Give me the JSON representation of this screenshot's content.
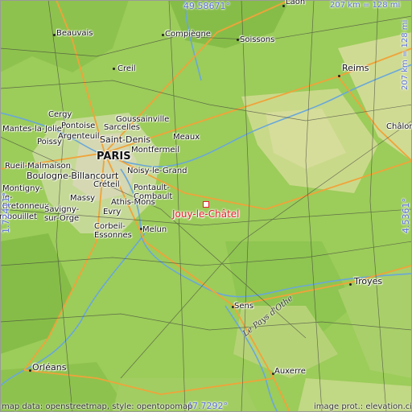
{
  "map": {
    "coordinates": {
      "top": "49.58671°",
      "bottom": "47.7292°",
      "left": "1.72411°",
      "right": "4.5361°",
      "scale_top": "207 km = 128 mi",
      "scale_right": "207 km = 128 mi"
    },
    "focus_place": "Jouy-le-Châtel",
    "places": [
      {
        "name": "Laon"
      },
      {
        "name": "Beauvais"
      },
      {
        "name": "Compiègne"
      },
      {
        "name": "Soissons"
      },
      {
        "name": "Creil"
      },
      {
        "name": "Reims"
      },
      {
        "name": "Goussainville"
      },
      {
        "name": "Cergy"
      },
      {
        "name": "Pontoise"
      },
      {
        "name": "Sarcelles"
      },
      {
        "name": "Mantes-la-Jolie"
      },
      {
        "name": "Argenteuil"
      },
      {
        "name": "Saint-Denis"
      },
      {
        "name": "Poissy"
      },
      {
        "name": "Meaux"
      },
      {
        "name": "Montfermeil"
      },
      {
        "name": "PARIS"
      },
      {
        "name": "Châlons-en-Champagne"
      },
      {
        "name": "Rueil-Malmaison"
      },
      {
        "name": "Boulogne-Billancourt"
      },
      {
        "name": "Noisy-le-Grand"
      },
      {
        "name": "Créteil"
      },
      {
        "name": "Pontault-Combault"
      },
      {
        "name": "Montigny-le-Bretonneux"
      },
      {
        "name": "Massy"
      },
      {
        "name": "Athis-Mons"
      },
      {
        "name": "Rambouillet"
      },
      {
        "name": "Savigny-sur-Orge"
      },
      {
        "name": "Evry"
      },
      {
        "name": "Corbeil-Essonnes"
      },
      {
        "name": "Melun"
      },
      {
        "name": "Troyes"
      },
      {
        "name": "Sens"
      },
      {
        "name": "Orléans"
      },
      {
        "name": "Auxerre"
      }
    ],
    "region_label": "Le Pays d'Othe",
    "credits": {
      "left": "map data: openstreetmap, style: opentopomap",
      "right": "image prot.: elevation.city"
    }
  }
}
